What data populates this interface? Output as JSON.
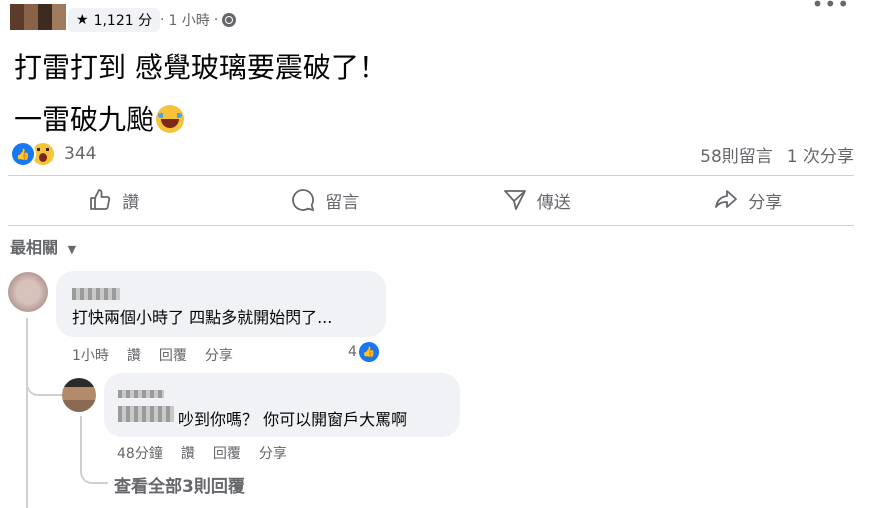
{
  "header": {
    "score_icon": "star-icon",
    "score": "1,121 分",
    "separator": "·",
    "time": "1 小時",
    "visibility_icon": "globe-icon",
    "more": "•••"
  },
  "post": {
    "line1": "打雷打到 感覺玻璃要震破了！",
    "line2": "一雷破九颱",
    "emoji": "tears-of-joy-emoji"
  },
  "reactions": {
    "icons": [
      "like-icon",
      "wow-icon"
    ],
    "count": "344",
    "comments": "58則留言",
    "shares": "1 次分享"
  },
  "actions": {
    "like": "讚",
    "comment": "留言",
    "send": "傳送",
    "share": "分享"
  },
  "sort": {
    "label": "最相關"
  },
  "comments": [
    {
      "text": "打快兩個小時了 四點多就開始閃了...",
      "time": "1小時",
      "like": "讚",
      "reply": "回覆",
      "share": "分享",
      "likes": "4"
    }
  ],
  "reply": {
    "text": "吵到你嗎？ 你可以開窗戶大罵啊",
    "time": "48分鐘",
    "like": "讚",
    "reply": "回覆",
    "share": "分享"
  },
  "view_replies": "查看全部3則回覆",
  "colors": {
    "accent": "#1877f2",
    "bubble": "#f0f2f5",
    "muted": "#65676b"
  }
}
